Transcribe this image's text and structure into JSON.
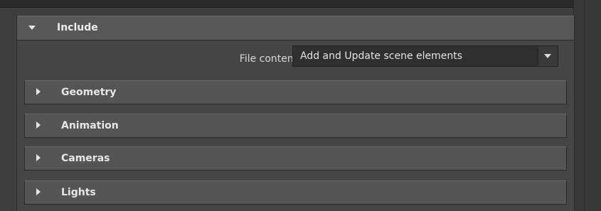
{
  "include_section": {
    "title": "Include",
    "file_content": {
      "label": "File content:",
      "value": "Add and Update scene elements"
    },
    "subsections": [
      {
        "label": "Geometry"
      },
      {
        "label": "Animation"
      },
      {
        "label": "Cameras"
      },
      {
        "label": "Lights"
      }
    ]
  },
  "icons": {
    "expanded": "triangle-down-icon",
    "collapsed": "triangle-right-icon",
    "dropdown": "chevron-down-icon"
  }
}
